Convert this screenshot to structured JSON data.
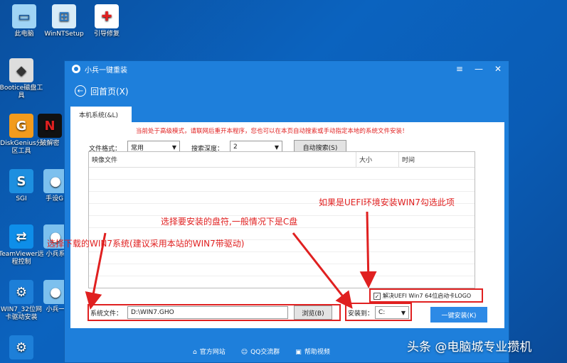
{
  "desktop": {
    "icons": [
      {
        "label": "此电脑",
        "icon": "computer-icon"
      },
      {
        "label": "WinNTSetup",
        "icon": "setup-icon"
      },
      {
        "label": "引导修复",
        "icon": "firstaid-icon"
      },
      {
        "label": "Bootice磁盘工具",
        "icon": "bootice-icon"
      },
      {
        "label": "DiskGenius分区工具",
        "icon": "diskgenius-icon"
      },
      {
        "label": "破解密",
        "icon": "nt-icon"
      },
      {
        "label": "SGI",
        "icon": "sgi-icon"
      },
      {
        "label": "手设GI",
        "icon": "manual-icon"
      },
      {
        "label": "TeamViewer远程控制",
        "icon": "teamviewer-icon"
      },
      {
        "label": "小兵系",
        "icon": "xiaobing-icon"
      },
      {
        "label": "WIN7_32位网卡驱动安装",
        "icon": "win7-driver-icon"
      },
      {
        "label": "小兵一",
        "icon": "xiaobing2-icon"
      }
    ]
  },
  "window": {
    "title": "小兵一键重装",
    "back_label": "回首页(X)",
    "tab_label": "本机系统(&L)",
    "warning": "当前处于高级模式，请联网后重开本程序，您也可以在本页自动搜索或手动指定本地的系统文件安装！",
    "file_format_label": "文件格式：",
    "file_format_value": "常用",
    "search_depth_label": "搜索深度：",
    "search_depth_value": "2",
    "auto_search_label": "自动搜索(S)",
    "table": {
      "columns": [
        "映像文件",
        "大小",
        "时间"
      ]
    },
    "system_file_label": "系统文件：",
    "system_file_value": "D:\\WIN7.GHO",
    "browse_label": "浏览(B)",
    "install_to_label": "安装到：",
    "install_to_value": "C:",
    "uefi_checkbox_label": "解决UEFI Win7 64位启动卡LOGO",
    "one_click_label": "一键安装(K)",
    "footer": [
      "官方网站",
      "QQ交流群",
      "帮助视频"
    ]
  },
  "annotations": {
    "uefi_note": "如果是UEFI环境安装WIN7勾选此项",
    "drive_note": "选择要安装的盘符,一般情况下是C盘",
    "system_note": "选择下载的WIN7系统(建议采用本站的WIN7带驱动)"
  },
  "watermark": "头条 @电脑城专业攒机",
  "colors": {
    "window_blue": "#1e7fdb",
    "annotation_red": "#e02020",
    "button_blue": "#2d8ae6"
  }
}
